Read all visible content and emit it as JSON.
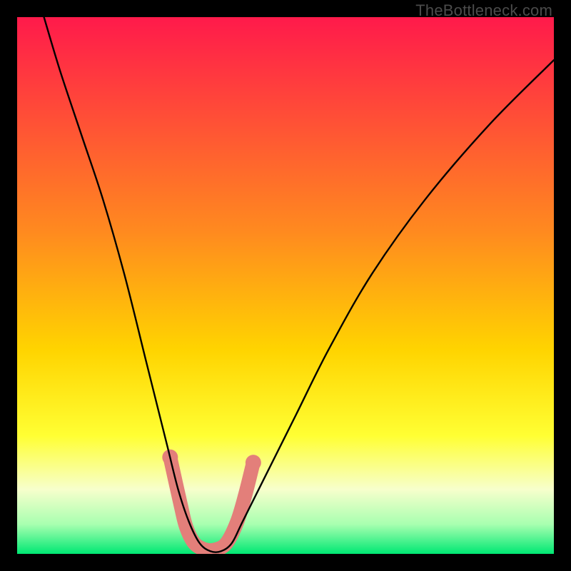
{
  "watermark": "TheBottleneck.com",
  "chart_data": {
    "type": "line",
    "title": "",
    "xlabel": "",
    "ylabel": "",
    "xlim": [
      0,
      100
    ],
    "ylim": [
      0,
      100
    ],
    "grid": false,
    "legend": false,
    "background_gradient": {
      "stops": [
        {
          "pos": 0.0,
          "color": "#ff1a4b"
        },
        {
          "pos": 0.4,
          "color": "#ff8a1f"
        },
        {
          "pos": 0.62,
          "color": "#ffd400"
        },
        {
          "pos": 0.78,
          "color": "#ffff33"
        },
        {
          "pos": 0.88,
          "color": "#f7ffcc"
        },
        {
          "pos": 0.945,
          "color": "#a8ffb0"
        },
        {
          "pos": 1.0,
          "color": "#00e873"
        }
      ]
    },
    "series": [
      {
        "name": "bottleneck-curve",
        "color": "#000000",
        "width": 2,
        "x": [
          5,
          8,
          12,
          16,
          20,
          24,
          26,
          28,
          30,
          32,
          34,
          36,
          38,
          40,
          42,
          46,
          52,
          58,
          66,
          76,
          88,
          100
        ],
        "y": [
          100,
          90,
          78,
          66,
          52,
          36,
          28,
          20,
          12,
          6,
          2,
          0.5,
          0.5,
          2,
          6,
          14,
          26,
          38,
          52,
          66,
          80,
          92
        ]
      }
    ],
    "markers": {
      "name": "highlight-band",
      "color": "#e37f7a",
      "points": [
        {
          "x": 28.5,
          "y": 18
        },
        {
          "x": 30.5,
          "y": 9
        },
        {
          "x": 31.5,
          "y": 5
        },
        {
          "x": 33.0,
          "y": 2
        },
        {
          "x": 35.0,
          "y": 0.8
        },
        {
          "x": 37.0,
          "y": 0.8
        },
        {
          "x": 39.0,
          "y": 2
        },
        {
          "x": 41.0,
          "y": 6
        },
        {
          "x": 42.5,
          "y": 11
        },
        {
          "x": 44.0,
          "y": 17
        }
      ]
    }
  }
}
